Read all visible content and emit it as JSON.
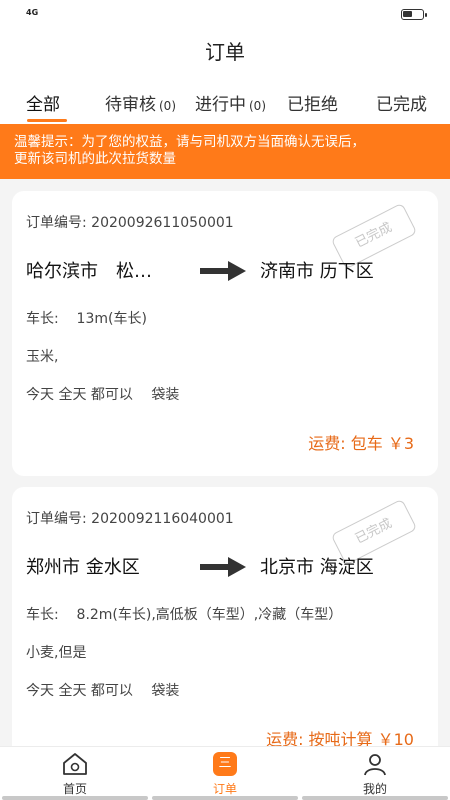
{
  "statusbar": {
    "network": "4G"
  },
  "header": {
    "title": "订单"
  },
  "tabs": [
    {
      "label": "全部",
      "count": ""
    },
    {
      "label": "待审核",
      "count": "(0)"
    },
    {
      "label": "进行中",
      "count": "(0)"
    },
    {
      "label": "已拒绝",
      "count": ""
    },
    {
      "label": "已完成",
      "count": ""
    }
  ],
  "notice": {
    "line1": "温馨提示：为了您的权益，请与司机双方当面确认无误后，",
    "line2": "更新该司机的此次拉货数量"
  },
  "orders": [
    {
      "id_label": "订单编号:",
      "id": "2020092611050001",
      "from": "哈尔滨市　松…",
      "to": "济南市  历下区",
      "length_label": "车长:",
      "length": "13m(车长)",
      "goods": "玉米,",
      "time": "今天 全天 都可以　 袋装",
      "fee": "运费: 包车 ￥3",
      "stamp": "已完成"
    },
    {
      "id_label": "订单编号:",
      "id": "2020092116040001",
      "from": "郑州市  金水区",
      "to": "北京市  海淀区",
      "length_label": "车长:",
      "length": "8.2m(车长),高低板（车型）,冷藏（车型）",
      "goods": "小麦,但是",
      "time": "今天 全天 都可以　 袋装",
      "fee": "运费: 按吨计算 ￥10",
      "stamp": "已完成"
    }
  ],
  "bottomnav": {
    "home": "首页",
    "orders": "订单",
    "orders_icon": "三",
    "mine": "我的"
  },
  "colors": {
    "accent": "#ff7a19",
    "fee": "#e76a18"
  }
}
